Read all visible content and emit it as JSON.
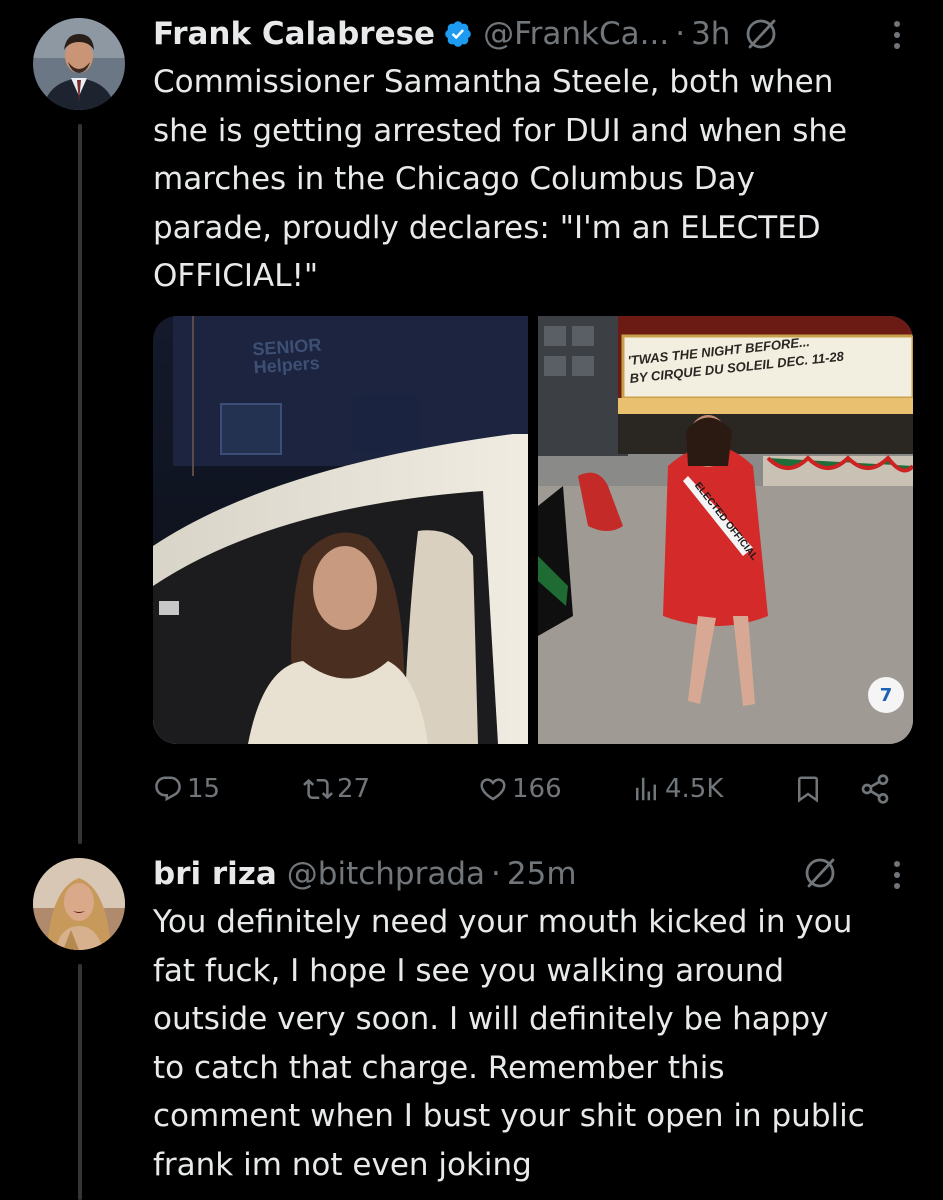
{
  "tweets": [
    {
      "name": "Frank Calabrese",
      "handle": "@FrankCa...",
      "time": "3h",
      "text": "Commissioner Samantha Steele, both when\nshe is getting arrested for DUI and when she\nmarches in the Chicago Columbus Day\nparade, proudly declares: \"I'm an ELECTED\nOFFICIAL!\"",
      "verified": true,
      "media": {
        "left_sign": "SENIOR\nHelpers",
        "right_marquee": "'TWAS THE NIGHT BEFORE...\nBY CIRQUE DU SOLEIL DEC. 11-28",
        "sash": "ELECTED OFFICIAL",
        "watermark": "abc 7"
      },
      "stats": {
        "replies": "15",
        "reposts": "27",
        "likes": "166",
        "views": "4.5K"
      }
    },
    {
      "name": "bri riza",
      "handle": "@bitchprada",
      "time": "25m",
      "text": "You definitely need your mouth kicked in you\nfat fuck,  I hope I see you walking around\noutside very  soon. I will definitely be happy\nto catch that charge. Remember this\ncomment when I bust your shit open in public\nfrank im not even joking"
    }
  ],
  "separator": "·",
  "colors": {
    "background": "#000000",
    "text": "#e7e9ea",
    "secondary": "#71767b",
    "verified": "#1d9bf0",
    "thread_line": "#333639"
  },
  "icons": [
    "verified-badge-icon",
    "muted-icon",
    "more-icon",
    "reply-icon",
    "repost-icon",
    "like-icon",
    "views-icon",
    "bookmark-icon",
    "share-icon"
  ]
}
